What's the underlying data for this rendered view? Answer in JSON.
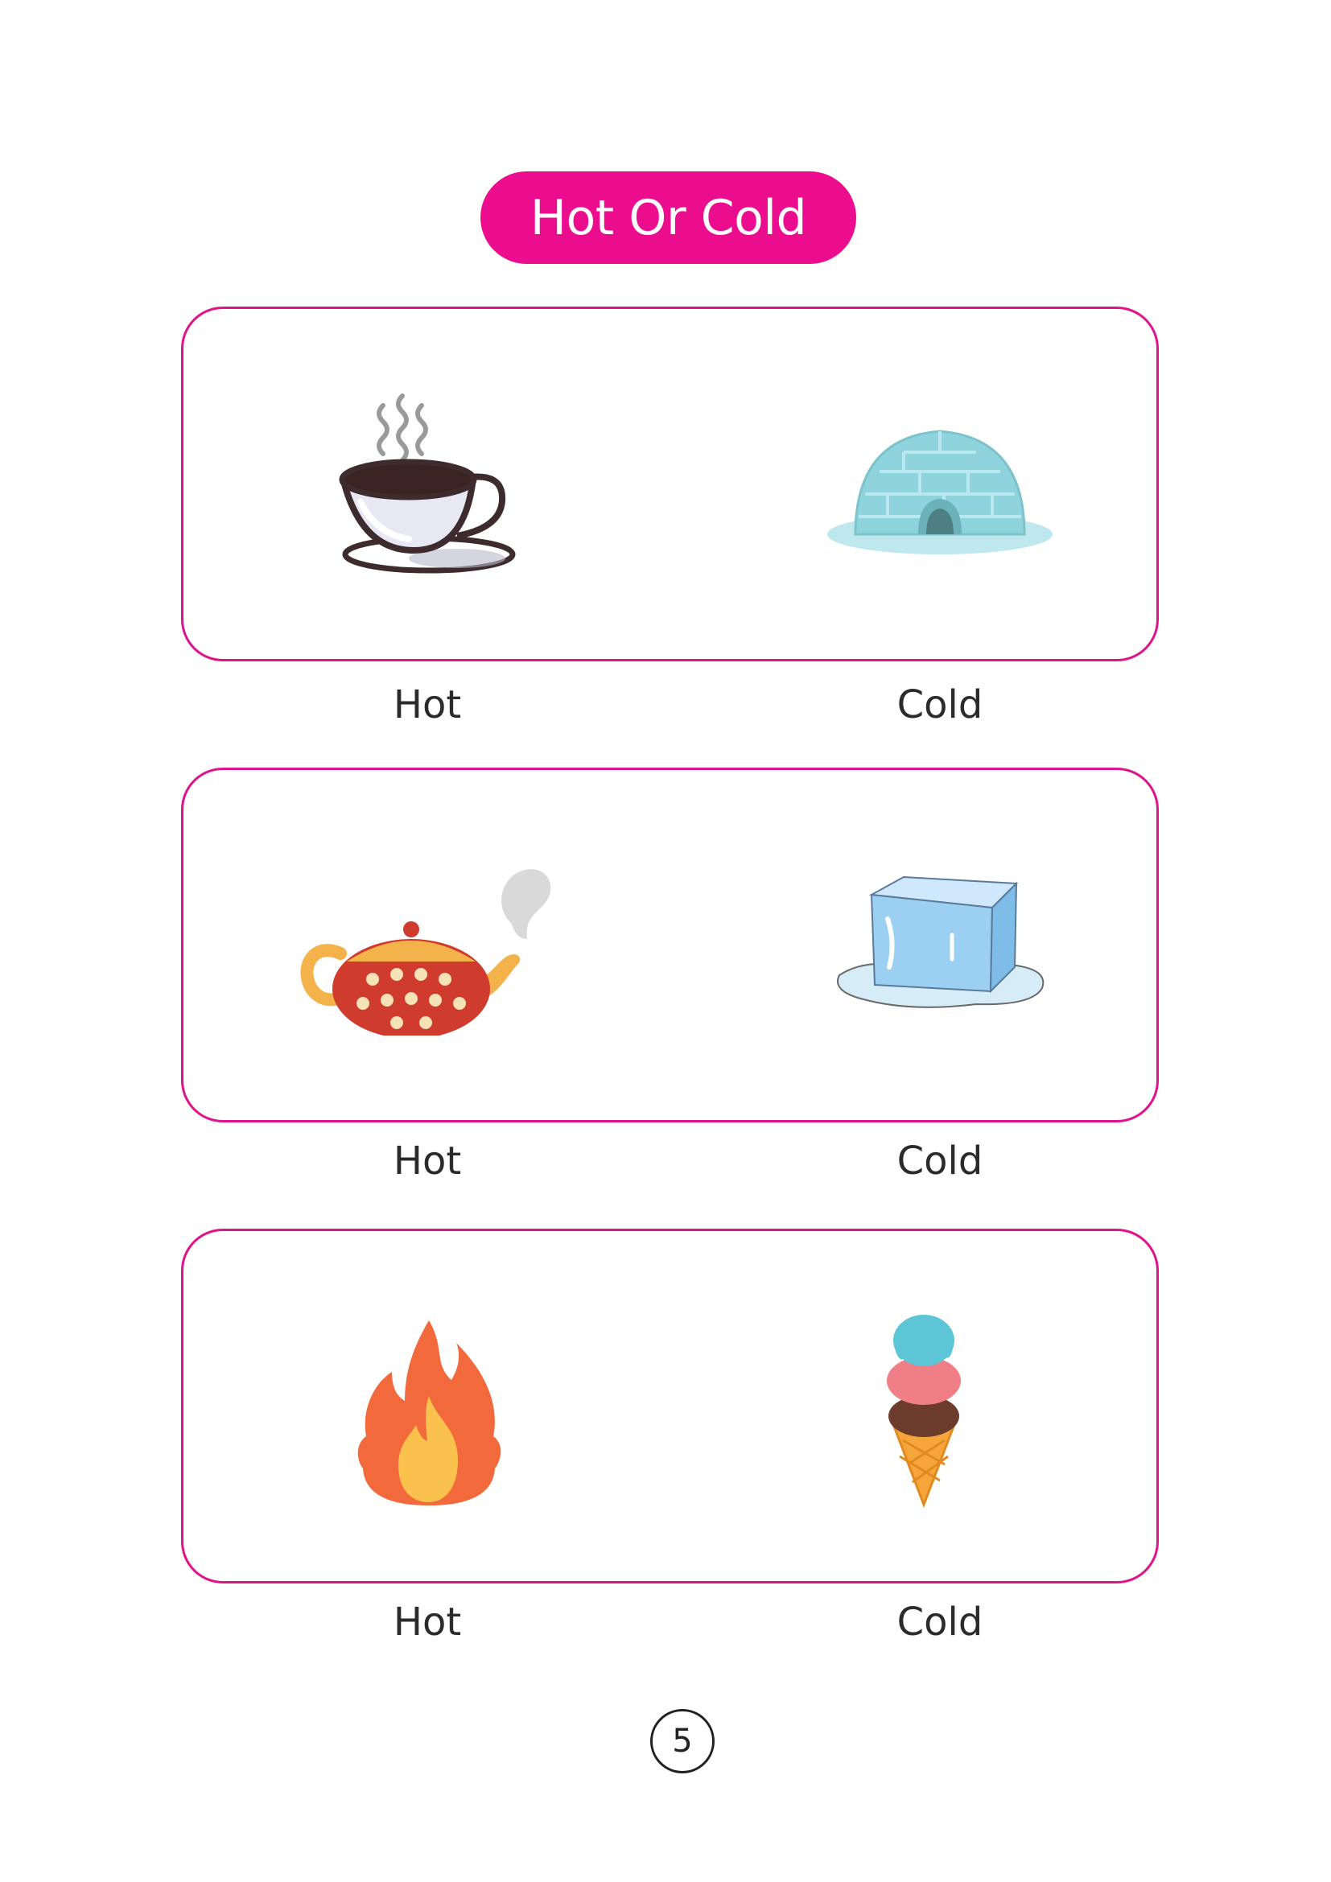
{
  "title": "Hot Or Cold",
  "rows": [
    {
      "hot": {
        "label": "Hot",
        "icon": "coffee-cup-icon"
      },
      "cold": {
        "label": "Cold",
        "icon": "igloo-icon"
      }
    },
    {
      "hot": {
        "label": "Hot",
        "icon": "teapot-icon"
      },
      "cold": {
        "label": "Cold",
        "icon": "ice-cube-icon"
      }
    },
    {
      "hot": {
        "label": "Hot",
        "icon": "fire-icon"
      },
      "cold": {
        "label": "Cold",
        "icon": "ice-cream-cone-icon"
      }
    }
  ],
  "page_number": "5",
  "colors": {
    "accent": "#ec0d8f",
    "card_border": "#e0148a"
  }
}
